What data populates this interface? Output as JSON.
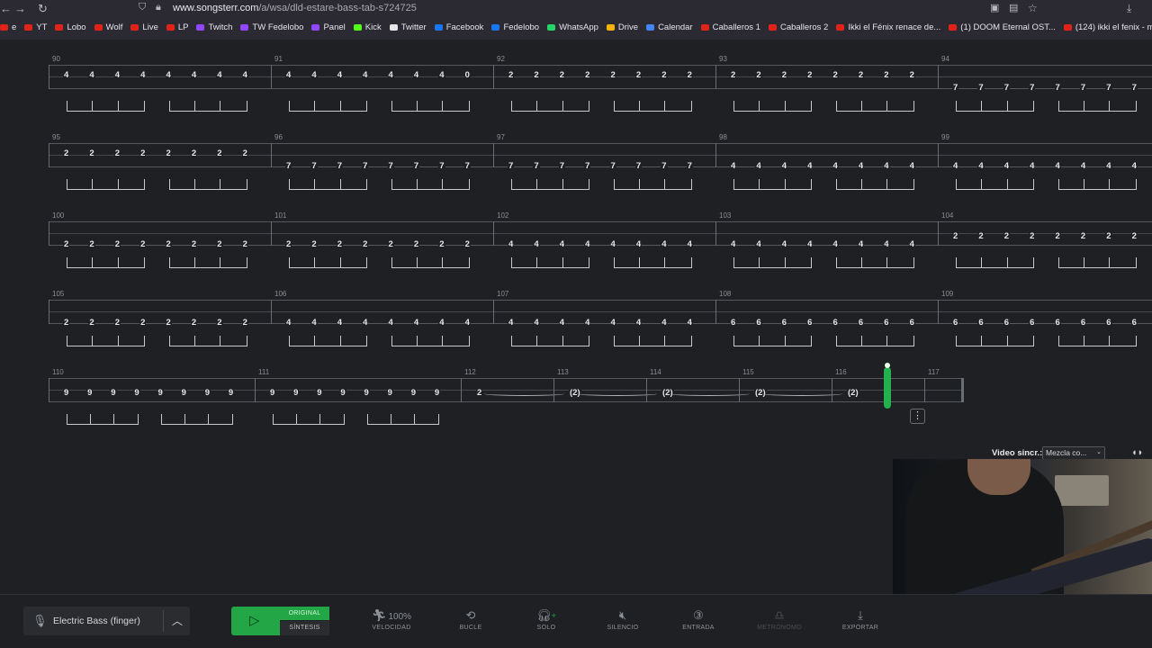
{
  "browser": {
    "url_domain": "www.songsterr.com",
    "url_path": "/a/wsa/dld-estare-bass-tab-s724725",
    "bookmarks": [
      {
        "label": "e",
        "color": "#e2231a"
      },
      {
        "label": "YT",
        "color": "#e2231a"
      },
      {
        "label": "Lobo",
        "color": "#e2231a"
      },
      {
        "label": "Wolf",
        "color": "#e2231a"
      },
      {
        "label": "Live",
        "color": "#e2231a"
      },
      {
        "label": "LP",
        "color": "#e2231a"
      },
      {
        "label": "Twitch",
        "color": "#9146ff"
      },
      {
        "label": "TW Fedelobo",
        "color": "#9146ff"
      },
      {
        "label": "Panel",
        "color": "#9146ff"
      },
      {
        "label": "Kick",
        "color": "#53fc18"
      },
      {
        "label": "Twitter",
        "color": "#e6e6e6"
      },
      {
        "label": "Facebook",
        "color": "#1877f2"
      },
      {
        "label": "Fedelobo",
        "color": "#1877f2"
      },
      {
        "label": "WhatsApp",
        "color": "#25d366"
      },
      {
        "label": "Drive",
        "color": "#f4b400"
      },
      {
        "label": "Calendar",
        "color": "#4285f4"
      },
      {
        "label": "Caballeros 1",
        "color": "#e2231a"
      },
      {
        "label": "Caballeros 2",
        "color": "#e2231a"
      },
      {
        "label": "Ikki el Fénix renace de...",
        "color": "#e2231a"
      },
      {
        "label": "(1) DOOM Eternal OST...",
        "color": "#e2231a"
      },
      {
        "label": "(124) ikki el fenix - me...",
        "color": "#e2231a"
      }
    ]
  },
  "tab": {
    "rows": [
      {
        "measures": [
          {
            "num": "90",
            "notes": [
              "4",
              "4",
              "4",
              "4",
              "4",
              "4",
              "4",
              "4"
            ]
          },
          {
            "num": "91",
            "notes": [
              "4",
              "4",
              "4",
              "4",
              "4",
              "4",
              "4",
              "0"
            ]
          },
          {
            "num": "92",
            "notes": [
              "2",
              "2",
              "2",
              "2",
              "2",
              "2",
              "2",
              "2"
            ]
          },
          {
            "num": "93",
            "notes": [
              "2",
              "2",
              "2",
              "2",
              "2",
              "2",
              "2",
              "2"
            ]
          },
          {
            "num": "94",
            "notes": [
              "7",
              "7",
              "7",
              "7",
              "7",
              "7",
              "7",
              "7"
            ]
          }
        ]
      },
      {
        "measures": [
          {
            "num": "95",
            "notes": [
              "2",
              "2",
              "2",
              "2",
              "2",
              "2",
              "2",
              "2"
            ]
          },
          {
            "num": "96",
            "notes": [
              "7",
              "7",
              "7",
              "7",
              "7",
              "7",
              "7",
              "7"
            ]
          },
          {
            "num": "97",
            "notes": [
              "7",
              "7",
              "7",
              "7",
              "7",
              "7",
              "7",
              "7"
            ]
          },
          {
            "num": "98",
            "notes": [
              "4",
              "4",
              "4",
              "4",
              "4",
              "4",
              "4",
              "4"
            ]
          },
          {
            "num": "99",
            "notes": [
              "4",
              "4",
              "4",
              "4",
              "4",
              "4",
              "4",
              "4"
            ]
          }
        ]
      },
      {
        "measures": [
          {
            "num": "100",
            "notes": [
              "2",
              "2",
              "2",
              "2",
              "2",
              "2",
              "2",
              "2"
            ]
          },
          {
            "num": "101",
            "notes": [
              "2",
              "2",
              "2",
              "2",
              "2",
              "2",
              "2",
              "2"
            ]
          },
          {
            "num": "102",
            "notes": [
              "4",
              "4",
              "4",
              "4",
              "4",
              "4",
              "4",
              "4"
            ]
          },
          {
            "num": "103",
            "notes": [
              "4",
              "4",
              "4",
              "4",
              "4",
              "4",
              "4",
              "4"
            ]
          },
          {
            "num": "104",
            "notes": [
              "2",
              "2",
              "2",
              "2",
              "2",
              "2",
              "2",
              "2"
            ]
          }
        ]
      },
      {
        "measures": [
          {
            "num": "105",
            "notes": [
              "2",
              "2",
              "2",
              "2",
              "2",
              "2",
              "2",
              "2"
            ]
          },
          {
            "num": "106",
            "notes": [
              "4",
              "4",
              "4",
              "4",
              "4",
              "4",
              "4",
              "4"
            ]
          },
          {
            "num": "107",
            "notes": [
              "4",
              "4",
              "4",
              "4",
              "4",
              "4",
              "4",
              "4"
            ]
          },
          {
            "num": "108",
            "notes": [
              "6",
              "6",
              "6",
              "6",
              "6",
              "6",
              "6",
              "6"
            ]
          },
          {
            "num": "109",
            "notes": [
              "6",
              "6",
              "6",
              "6",
              "6",
              "6",
              "6",
              "6"
            ]
          }
        ]
      },
      {
        "measures": [
          {
            "num": "110",
            "notes": [
              "9",
              "9",
              "9",
              "9",
              "9",
              "9",
              "9",
              "9"
            ]
          },
          {
            "num": "111",
            "notes": [
              "9",
              "9",
              "9",
              "9",
              "9",
              "9",
              "9",
              "9"
            ]
          },
          {
            "num": "112",
            "notes": [
              "2"
            ]
          },
          {
            "num": "113",
            "notes": [
              "(2)"
            ]
          },
          {
            "num": "114",
            "notes": [
              "(2)"
            ]
          },
          {
            "num": "115",
            "notes": [
              "(2)"
            ]
          },
          {
            "num": "116",
            "notes": [
              "(2)"
            ]
          },
          {
            "num": "117",
            "notes": []
          }
        ]
      }
    ]
  },
  "video": {
    "label": "Video sincr.:",
    "select_value": "Mezcla co...",
    "progress_note": ""
  },
  "toolbar": {
    "instrument": "Electric Bass (finger)",
    "mode_original": "ORIGINAL",
    "mode_synth": "SÍNTESIS",
    "speed_value": "100%",
    "speed_label": "VELOCIDAD",
    "loop_label": "BUCLE",
    "solo_label": "SOLO",
    "mute_label": "SILENCIO",
    "countin_label": "ENTRADA",
    "metronome_label": "METRÓNOMO",
    "export_label": "EXPORTAR"
  }
}
